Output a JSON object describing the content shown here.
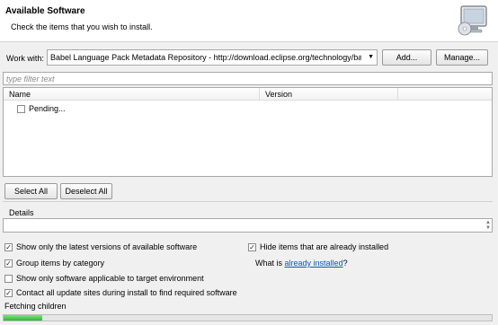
{
  "header": {
    "title": "Available Software",
    "subtitle": "Check the items that you wish to install."
  },
  "work_with": {
    "label": "Work with:",
    "value": "Babel Language Pack Metadata Repository - http://download.eclipse.org/technology/babel/upc",
    "add_label": "Add...",
    "manage_label": "Manage..."
  },
  "filter": {
    "placeholder": "type filter text"
  },
  "tree": {
    "columns": [
      "Name",
      "Version"
    ],
    "rows": [
      {
        "name": "Pending...",
        "version": "",
        "checked": false
      }
    ]
  },
  "buttons": {
    "select_all": "Select All",
    "deselect_all": "Deselect All"
  },
  "details": {
    "label": "Details"
  },
  "options": {
    "latest_versions": {
      "label": "Show only the latest versions of available software",
      "checked": true
    },
    "group_by_category": {
      "label": "Group items by category",
      "checked": true
    },
    "target_env": {
      "label": "Show only software applicable to target environment",
      "checked": false
    },
    "contact_sites": {
      "label": "Contact all update sites during install to find required software",
      "checked": true
    },
    "hide_installed": {
      "label": "Hide items that are already installed",
      "checked": true
    },
    "what_is_prefix": "What is ",
    "what_is_link": "already installed",
    "what_is_suffix": "?"
  },
  "status": {
    "text": "Fetching children",
    "progress": 0.08,
    "progress_color": "#2fb82f"
  }
}
